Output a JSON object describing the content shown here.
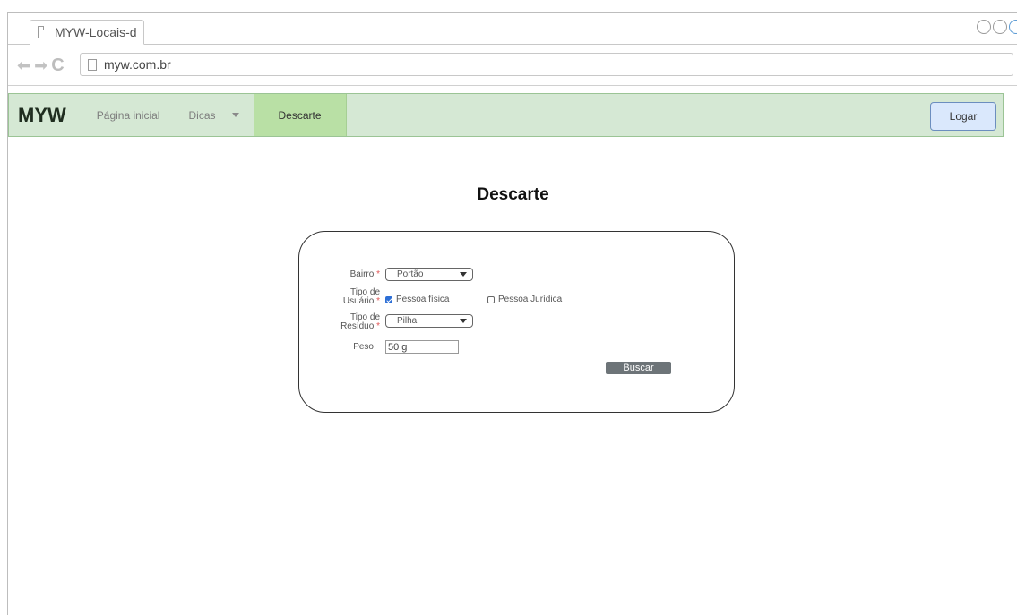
{
  "browser": {
    "tab_title": "MYW-Locais-d",
    "url": "myw.com.br"
  },
  "navbar": {
    "brand": "MYW",
    "home_label": "Página inicial",
    "tips_label": "Dicas",
    "active_label": "Descarte",
    "login_label": "Logar"
  },
  "page": {
    "title": "Descarte"
  },
  "form": {
    "bairro_label": "Bairro",
    "bairro_value": "Portão",
    "user_type_label_1": "Tipo de",
    "user_type_label_2": "Usuário",
    "option_fisica": "Pessoa física",
    "option_fisica_checked": true,
    "option_juridica": "Pessoa Jurídica",
    "option_juridica_checked": false,
    "residue_label_1": "Tipo de",
    "residue_label_2": "Resíduo",
    "residue_value": "Pilha",
    "weight_label": "Peso",
    "weight_value": "50 g",
    "required_mark": "*",
    "search_label": "Buscar"
  },
  "colors": {
    "navbar_bg": "#d5e8d4",
    "nav_active_bg": "#b9e0a5",
    "login_bg": "#dae8fc",
    "search_bg": "#6d7478",
    "checkbox_checked": "#2d6fd6"
  }
}
